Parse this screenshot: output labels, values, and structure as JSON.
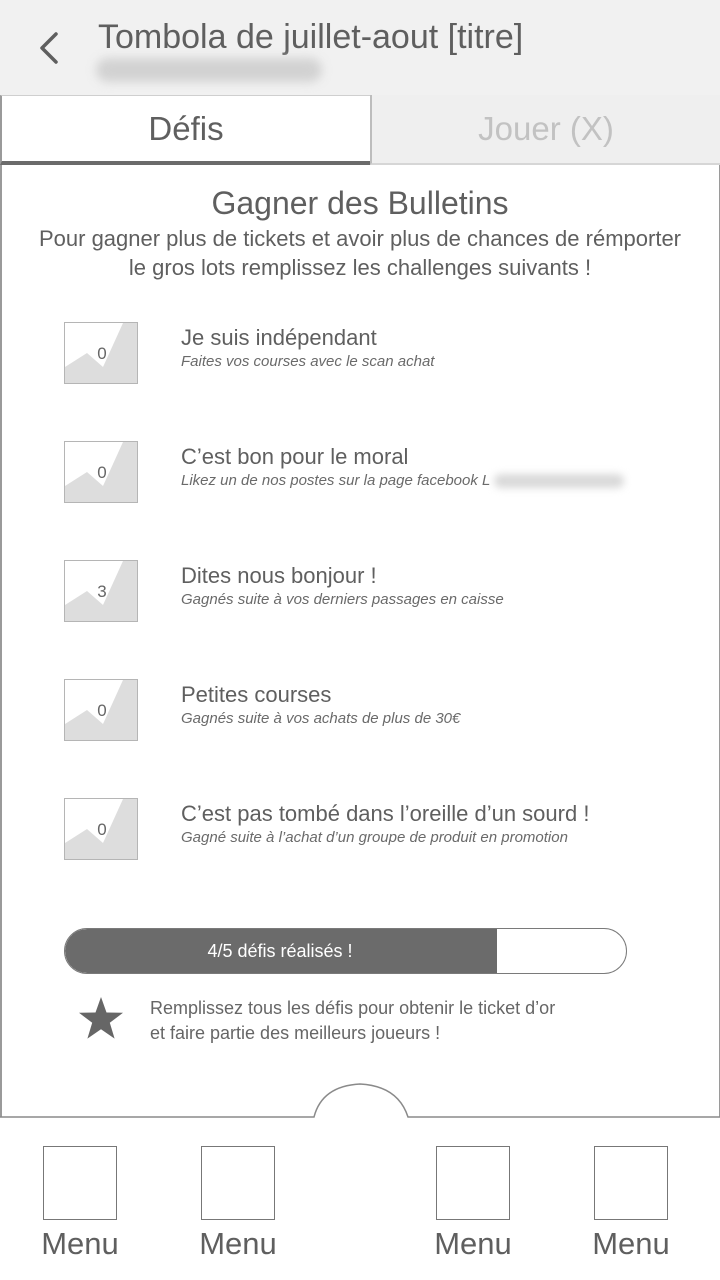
{
  "header": {
    "title": "Tombola de juillet-aout [titre]",
    "back_icon": "chevron-left-icon"
  },
  "tabs": [
    {
      "label": "Défis",
      "active": true
    },
    {
      "label": "Jouer (X)",
      "active": false
    }
  ],
  "section": {
    "title": "Gagner des Bulletins",
    "description": "Pour gagner plus de tickets et avoir plus de chances de rémporter le gros lots remplissez les challenges suivants !"
  },
  "challenges": [
    {
      "count": "0",
      "title": "Je suis indépendant",
      "subtitle": "Faites vos courses avec le scan achat"
    },
    {
      "count": "0",
      "title": "C’est bon pour le moral",
      "subtitle": "Likez un de nos postes sur la page facebook L"
    },
    {
      "count": "3",
      "title": "Dites nous bonjour !",
      "subtitle": "Gagnés suite à vos derniers passages en caisse"
    },
    {
      "count": "0",
      "title": "Petites courses",
      "subtitle": "Gagnés suite à vos achats de plus de 30€"
    },
    {
      "count": "0",
      "title": "C’est pas tombé dans l’oreille d’un sourd !",
      "subtitle": "Gagné suite à l’achat d’un groupe de produit en promotion"
    }
  ],
  "progress": {
    "label": "4/5 défis réalisés !",
    "fraction": 0.77
  },
  "gold_ticket": {
    "icon": "star-icon",
    "line1": "Remplissez tous les défis pour obtenir le ticket d’or",
    "line2": "et faire partie des meilleurs joueurs !"
  },
  "nav": [
    {
      "label": "Menu"
    },
    {
      "label": "Menu"
    },
    {
      "label": "Menu"
    },
    {
      "label": "Menu"
    }
  ],
  "colors": {
    "header_bg": "#f1f1f1",
    "progress_fill": "#6b6b6b",
    "text": "#5f5f5f"
  }
}
